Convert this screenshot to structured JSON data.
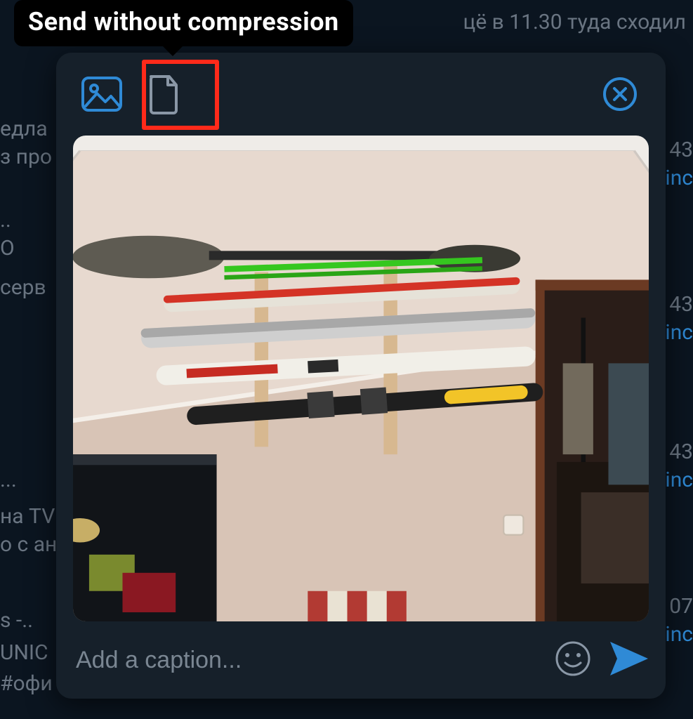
{
  "tooltip_text": "Send without compression",
  "caption_placeholder": "Add a caption...",
  "background": {
    "top_right": "цё в 11.30 туда сходил",
    "left_1": "едла",
    "left_2": "з про",
    "left_3": "..",
    "left_4": "О",
    "left_5": "серв",
    "left_6": "...",
    "left_7": "на TV",
    "left_8": "о с ан",
    "left_9": "s -..",
    "left_10": "UNIC",
    "left_11": "#офи",
    "time_1": "43",
    "link_1": "inc",
    "time_2": "43",
    "link_2": "inc",
    "time_3": "43",
    "link_3": "inc",
    "time_4": "07",
    "link_4": "inc"
  },
  "icons": {
    "photo_mode": "photo-icon",
    "file_mode": "file-icon",
    "close": "close-icon",
    "emoji": "emoji-icon",
    "send": "send-icon"
  },
  "colors": {
    "accent": "#2f8ad6",
    "highlight": "#ff2a1a",
    "modal_bg": "#16202a",
    "page_bg": "#0b1520"
  }
}
